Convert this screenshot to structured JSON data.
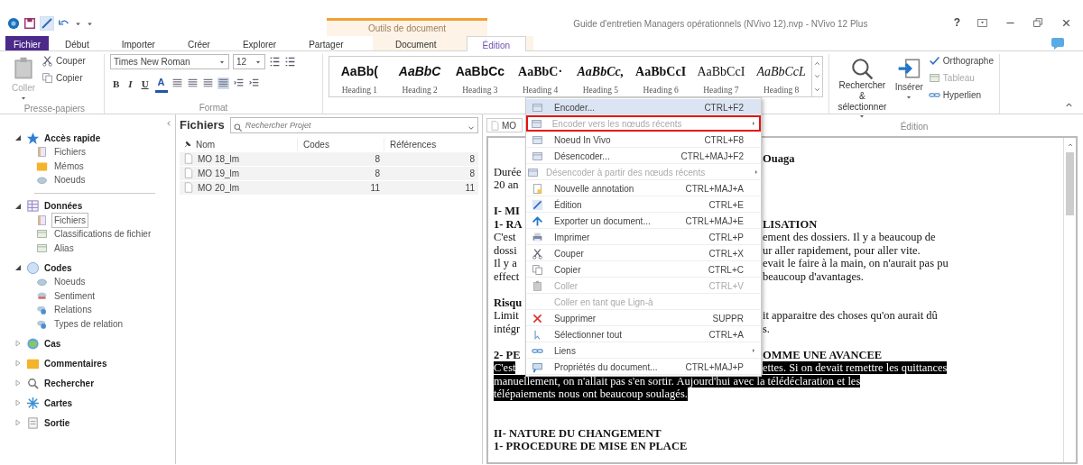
{
  "window": {
    "title": "Guide d'entretien Managers opérationnels (NVivo 12).nvp - NVivo 12 Plus",
    "help": "?"
  },
  "contextual_group": {
    "label": "Outils de document"
  },
  "ribbon_tabs": [
    {
      "label": "Fichier",
      "kind": "file",
      "selected": false
    },
    {
      "label": "Début",
      "kind": "normal",
      "selected": false
    },
    {
      "label": "Importer",
      "kind": "normal",
      "selected": false
    },
    {
      "label": "Créer",
      "kind": "normal",
      "selected": false
    },
    {
      "label": "Explorer",
      "kind": "normal",
      "selected": false
    },
    {
      "label": "Partager",
      "kind": "normal",
      "selected": false
    },
    {
      "label": "Document",
      "kind": "contextual",
      "selected": false
    },
    {
      "label": "Édition",
      "kind": "contextual",
      "selected": true
    }
  ],
  "clipboard": {
    "paste": "Coller",
    "paste_disabled": true,
    "cut": "Couper",
    "copy": "Copier",
    "group": "Presse-papiers"
  },
  "format": {
    "font": "Times New Roman",
    "size": "12",
    "bold": "B",
    "italic": "I",
    "underline": "U",
    "font_color": "A",
    "group": "Format"
  },
  "styles": [
    {
      "sample": "AaBb(",
      "label": "Heading 1"
    },
    {
      "sample": "AaBbC",
      "label": "Heading 2"
    },
    {
      "sample": "AaBbCc",
      "label": "Heading 3"
    },
    {
      "sample": "AaBbC·",
      "label": "Heading 4"
    },
    {
      "sample": "AaBbCc,",
      "label": "Heading 5"
    },
    {
      "sample": "AaBbCcI",
      "label": "Heading 6"
    },
    {
      "sample": "AaBbCcI",
      "label": "Heading 7"
    },
    {
      "sample": "AaBbCcL",
      "label": "Heading 8"
    }
  ],
  "editing": {
    "find": "Rechercher &",
    "find_2": "sélectionner",
    "insert": "Insérer",
    "spelling": "Orthographe",
    "table": "Tableau",
    "table_disabled": true,
    "hyperlink": "Hyperlien",
    "group": "Édition"
  },
  "navigation": [
    {
      "label": "Accès rapide",
      "kind": "star",
      "expanded": true,
      "children": [
        {
          "label": "Fichiers",
          "kind": "page",
          "selected": false
        },
        {
          "label": "Mémos",
          "kind": "folder",
          "selected": false
        },
        {
          "label": "Noeuds",
          "kind": "node",
          "selected": false
        }
      ]
    },
    {
      "label": "Données",
      "kind": "grid",
      "expanded": true,
      "children": [
        {
          "label": "Fichiers",
          "kind": "page",
          "selected": true
        },
        {
          "label": "Classifications de fichier",
          "kind": "classif",
          "selected": false
        },
        {
          "label": "Alias",
          "kind": "classif",
          "selected": false
        }
      ]
    },
    {
      "label": "Codes",
      "kind": "circle",
      "expanded": true,
      "children": [
        {
          "label": "Noeuds",
          "kind": "node",
          "selected": false
        },
        {
          "label": "Sentiment",
          "kind": "sentiment",
          "selected": false
        },
        {
          "label": "Relations",
          "kind": "relation",
          "selected": false
        },
        {
          "label": "Types de relation",
          "kind": "relation",
          "selected": false
        }
      ]
    },
    {
      "label": "Cas",
      "kind": "globe",
      "expanded": false
    },
    {
      "label": "Commentaires",
      "kind": "folder",
      "expanded": false
    },
    {
      "label": "Rechercher",
      "kind": "search",
      "expanded": false
    },
    {
      "label": "Cartes",
      "kind": "cluster",
      "expanded": false
    },
    {
      "label": "Sortie",
      "kind": "output",
      "expanded": false
    }
  ],
  "file_list": {
    "title": "Fichiers",
    "search_placeholder": "Rechercher Projet",
    "columns": [
      "Nom",
      "Codes",
      "Références"
    ],
    "rows": [
      {
        "name": "MO 18_lm",
        "codes": "8",
        "references": "8"
      },
      {
        "name": "MO 19_lm",
        "codes": "8",
        "references": "8"
      },
      {
        "name": "MO 20_lm",
        "codes": "11",
        "references": "11"
      }
    ]
  },
  "document": {
    "tab": "MO",
    "lines": [
      {
        "kind": "text",
        "right": "Ouaga",
        "bold": true,
        "highlighted": false
      },
      {
        "kind": "text",
        "left": "Durée",
        "bold": false,
        "highlighted": false
      },
      {
        "kind": "text",
        "left": "20 an",
        "bold": false,
        "highlighted": false
      },
      {
        "kind": "blank"
      },
      {
        "kind": "text",
        "left": "I- MI",
        "bold": true,
        "highlighted": false
      },
      {
        "kind": "text",
        "left": "1- RA",
        "right": "LISATION",
        "bold": true,
        "highlighted": false
      },
      {
        "kind": "text",
        "left": "C'est",
        "right": "ement des dossiers. Il y a beaucoup de",
        "bold": false,
        "highlighted": false
      },
      {
        "kind": "text",
        "left": "dossi",
        "right": "ur aller rapidement, pour aller vite.",
        "bold": false,
        "highlighted": false
      },
      {
        "kind": "text",
        "left": "Il y a",
        "right": "evait le faire à la main, on n'aurait pas pu",
        "bold": false,
        "highlighted": false
      },
      {
        "kind": "text",
        "left": "effect",
        "right": "beaucoup d'avantages.",
        "bold": false,
        "highlighted": false
      },
      {
        "kind": "blank"
      },
      {
        "kind": "text",
        "left": "Risqu",
        "bold": true,
        "highlighted": false
      },
      {
        "kind": "text",
        "left": "Limit",
        "right": "it apparaitre des choses qu'on aurait dû",
        "bold": false,
        "highlighted": false
      },
      {
        "kind": "text",
        "left": "intégr",
        "right": "s.",
        "bold": false,
        "highlighted": false
      },
      {
        "kind": "blank"
      },
      {
        "kind": "text",
        "left": "2- PE",
        "right": "OMME UNE AVANCEE",
        "bold": true,
        "highlighted": false
      },
      {
        "kind": "text",
        "left": "C'est",
        "right": "ettes. Si on devait remettre les quittances",
        "bold": false,
        "highlighted": true
      },
      {
        "kind": "text",
        "full": "manuellement, on n'allait pas s'en sortir. Aujourd'hui avec la télédéclaration et les",
        "bold": false,
        "highlighted": true
      },
      {
        "kind": "text",
        "full": "télépaiements nous ont beaucoup soulagés.",
        "bold": false,
        "highlighted": true
      },
      {
        "kind": "blank"
      },
      {
        "kind": "blank"
      },
      {
        "kind": "text",
        "full": "II- NATURE DU CHANGEMENT",
        "bold": true,
        "highlighted": false
      },
      {
        "kind": "text",
        "full": "1- PROCEDURE DE MISE EN PLACE",
        "bold": true,
        "highlighted": false
      }
    ]
  },
  "context_menu": [
    {
      "label": "Encoder...",
      "shortcut": "CTRL+F2",
      "kind": "window",
      "disabled": false,
      "submenu": false,
      "hovered": true,
      "annotated": false
    },
    {
      "label": "Encoder vers les nœuds récents",
      "kind": "window",
      "disabled": true,
      "submenu": true,
      "hovered": false,
      "annotated": true
    },
    {
      "label": "Noeud In Vivo",
      "shortcut": "CTRL+F8",
      "kind": "window",
      "disabled": false,
      "submenu": false,
      "hovered": false,
      "annotated": false
    },
    {
      "label": "Désencoder...",
      "shortcut": "CTRL+MAJ+F2",
      "kind": "window",
      "disabled": false,
      "submenu": false,
      "hovered": false,
      "annotated": false
    },
    {
      "label": "Désencoder à partir des nœuds récents",
      "kind": "window",
      "disabled": true,
      "submenu": true,
      "hovered": false,
      "annotated": false
    },
    {
      "label": "Nouvelle annotation",
      "shortcut": "CTRL+MAJ+A",
      "kind": "note",
      "disabled": false,
      "submenu": false,
      "hovered": false,
      "annotated": false
    },
    {
      "label": "Édition",
      "shortcut": "CTRL+E",
      "kind": "pencil",
      "disabled": false,
      "submenu": false,
      "hovered": false,
      "annotated": false
    },
    {
      "label": "Exporter un document...",
      "shortcut": "CTRL+MAJ+E",
      "kind": "export",
      "disabled": false,
      "submenu": false,
      "hovered": false,
      "annotated": false
    },
    {
      "label": "Imprimer",
      "shortcut": "CTRL+P",
      "kind": "printer",
      "disabled": false,
      "submenu": false,
      "hovered": false,
      "annotated": false
    },
    {
      "label": "Couper",
      "shortcut": "CTRL+X",
      "kind": "scissors",
      "disabled": false,
      "submenu": false,
      "hovered": false,
      "annotated": false
    },
    {
      "label": "Copier",
      "shortcut": "CTRL+C",
      "kind": "copy",
      "disabled": false,
      "submenu": false,
      "hovered": false,
      "annotated": false
    },
    {
      "label": "Coller",
      "shortcut": "CTRL+V",
      "kind": "paste",
      "disabled": true,
      "submenu": false,
      "hovered": false,
      "annotated": false
    },
    {
      "label": "Coller en tant que Lign-à",
      "kind": "plain",
      "disabled": true,
      "submenu": false,
      "hovered": false,
      "annotated": false
    },
    {
      "label": "Supprimer",
      "shortcut": "SUPPR",
      "kind": "cross",
      "disabled": false,
      "submenu": false,
      "hovered": false,
      "annotated": false
    },
    {
      "label": "Sélectionner tout",
      "shortcut": "CTRL+A",
      "kind": "cursor",
      "disabled": false,
      "submenu": false,
      "hovered": false,
      "annotated": false
    },
    {
      "label": "Liens",
      "kind": "link",
      "disabled": false,
      "submenu": true,
      "hovered": false,
      "annotated": false
    },
    {
      "label": "Propriétés du document...",
      "shortcut": "CTRL+MAJ+P",
      "kind": "props",
      "disabled": false,
      "submenu": false,
      "hovered": false,
      "annotated": false
    }
  ]
}
